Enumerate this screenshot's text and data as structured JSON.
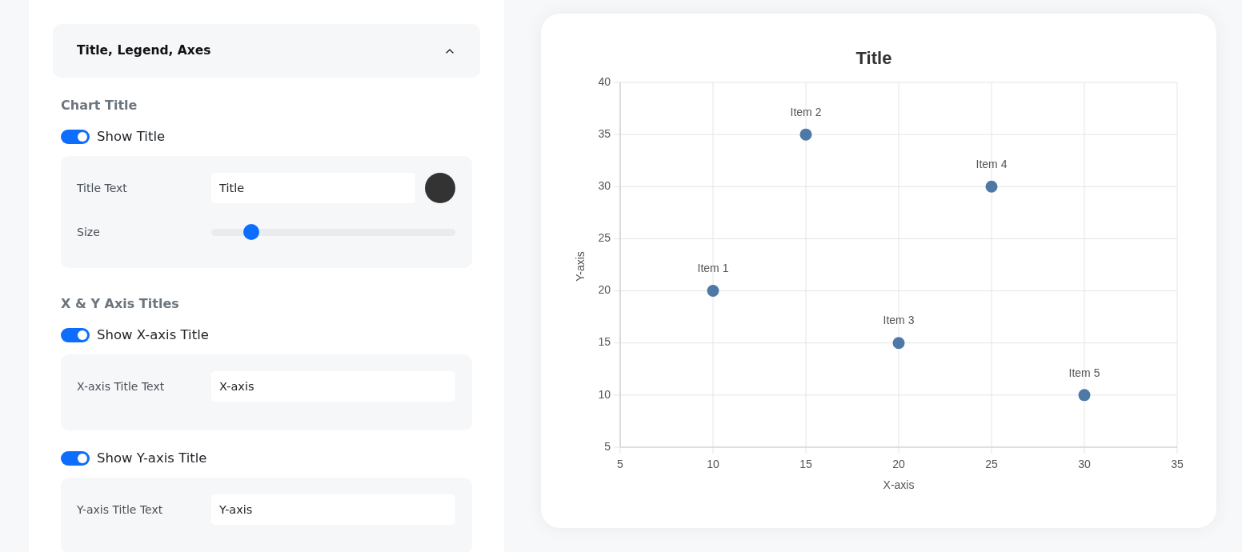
{
  "settings": {
    "section": {
      "title": "Title, Legend, Axes",
      "expanded": true
    },
    "groups": [
      {
        "heading": "Chart Title",
        "options": [
          {
            "toggle": {
              "label": "Show Title",
              "on": true
            },
            "fields": [
              {
                "kind": "text",
                "label": "Title Text",
                "value": "Title",
                "color": "#333333"
              },
              {
                "kind": "slider",
                "label": "Size",
                "level": 0.14
              }
            ]
          }
        ]
      },
      {
        "heading": "X & Y Axis Titles",
        "options": [
          {
            "toggle": {
              "label": "Show X-axis Title",
              "on": true
            },
            "fields": [
              {
                "kind": "text",
                "label": "X-axis Title Text",
                "value": "X-axis"
              }
            ]
          },
          {
            "toggle": {
              "label": "Show Y-axis Title",
              "on": true
            },
            "fields": [
              {
                "kind": "text",
                "label": "Y-axis Title Text",
                "value": "Y-axis"
              }
            ]
          }
        ]
      }
    ]
  },
  "chart": {
    "chart_data": {
      "type": "scatter",
      "title": "Title",
      "xlabel": "X-axis",
      "ylabel": "Y-axis",
      "x": [
        10,
        15,
        20,
        25,
        30
      ],
      "series": [
        {
          "color": "#4e79a7",
          "values": [
            20,
            35,
            15,
            30,
            10
          ]
        }
      ],
      "xlim": [
        5,
        35
      ],
      "ylim": [
        5,
        40
      ],
      "xticks": [
        5,
        10,
        15,
        20,
        25,
        30,
        35
      ],
      "yticks": [
        5,
        10,
        15,
        20,
        25,
        30,
        35,
        40
      ],
      "grid": true,
      "annotations": [
        {
          "text": "Item 1",
          "x": 10,
          "y": 20
        },
        {
          "text": "Item 2",
          "x": 15,
          "y": 35
        },
        {
          "text": "Item 3",
          "x": 20,
          "y": 15
        },
        {
          "text": "Item 4",
          "x": 25,
          "y": 30
        },
        {
          "text": "Item 5",
          "x": 30,
          "y": 10
        }
      ]
    }
  }
}
